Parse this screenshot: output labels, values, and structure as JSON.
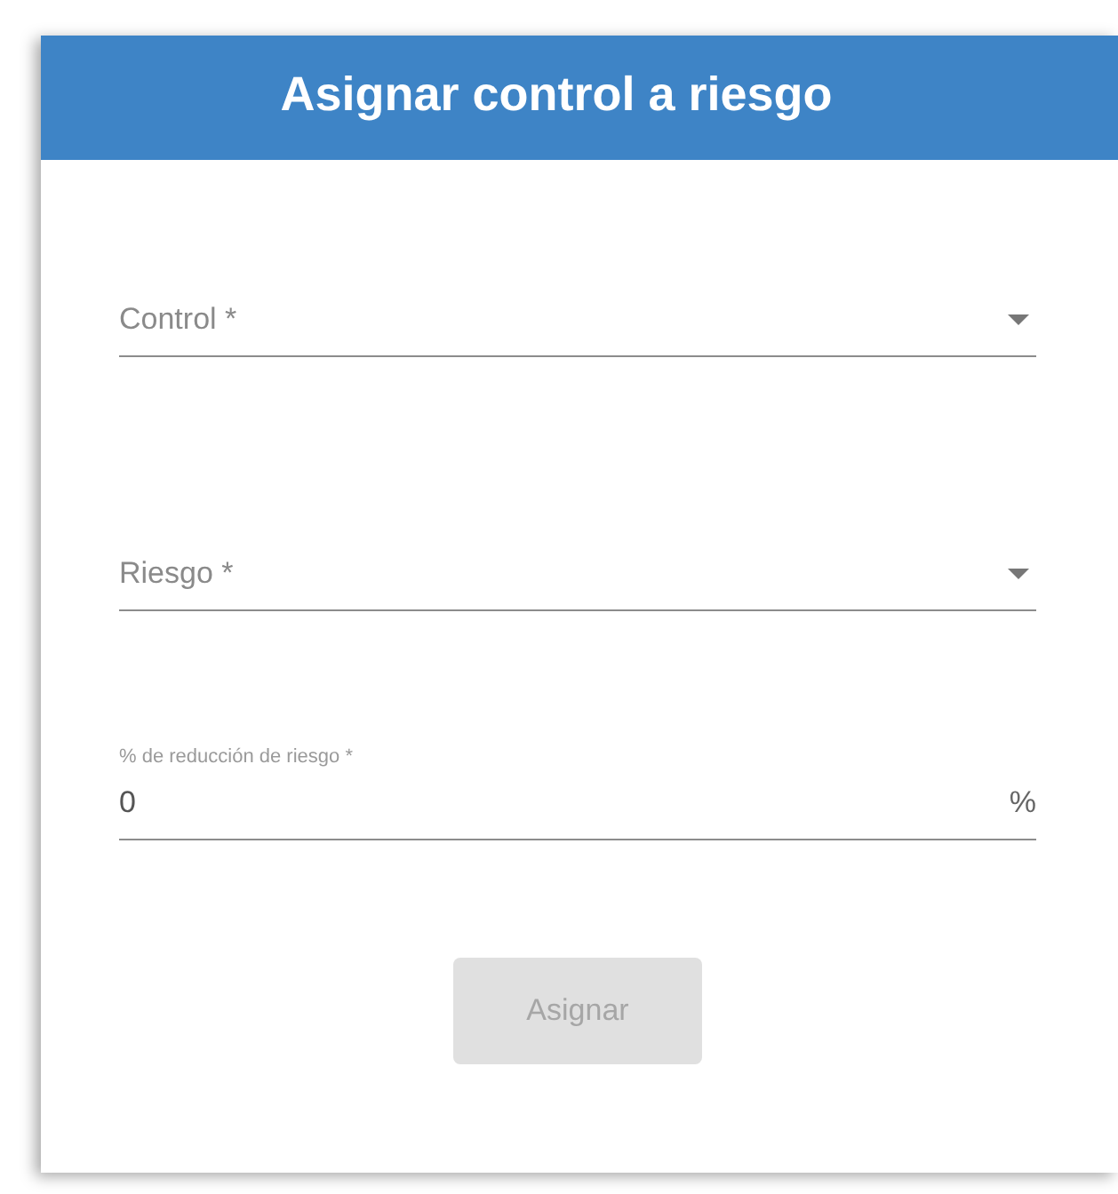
{
  "dialog": {
    "title": "Asignar control a riesgo"
  },
  "fields": [
    {
      "kind": "select",
      "label": "Control *"
    },
    {
      "kind": "select",
      "label": "Riesgo *"
    },
    {
      "kind": "number",
      "label": "% de reducción de riesgo *",
      "value": "0",
      "suffix": "%"
    }
  ],
  "button": {
    "label": "Asignar",
    "disabled": true
  }
}
